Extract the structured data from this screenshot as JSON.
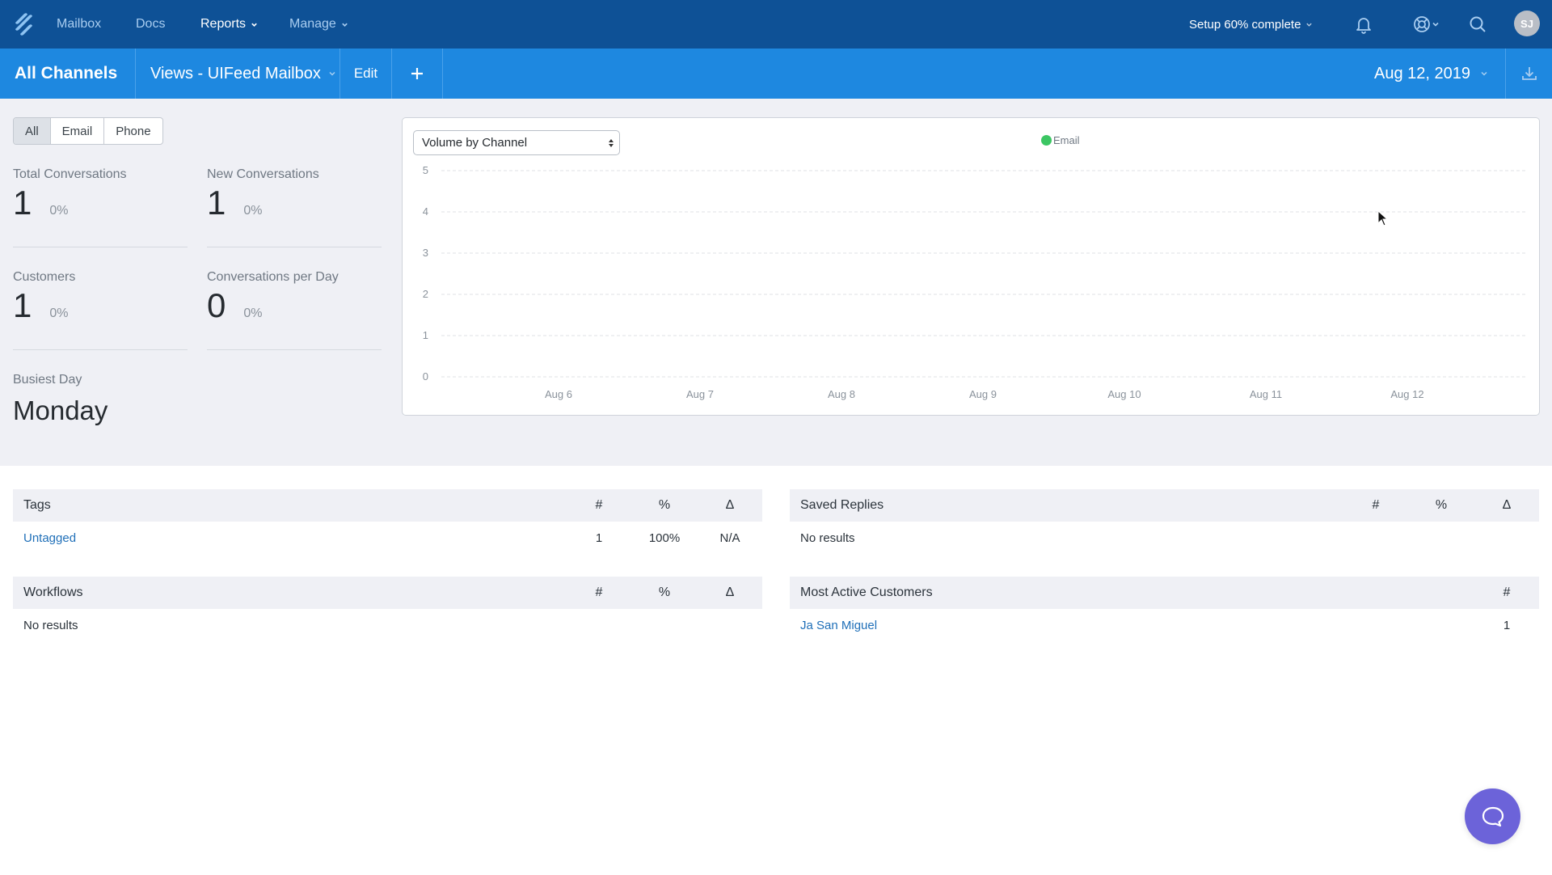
{
  "nav": {
    "items": [
      {
        "label": "Mailbox",
        "dropdown": false,
        "active": false
      },
      {
        "label": "Docs",
        "dropdown": false,
        "active": false
      },
      {
        "label": "Reports",
        "dropdown": true,
        "active": true
      },
      {
        "label": "Manage",
        "dropdown": true,
        "active": false
      }
    ],
    "setup_label": "Setup 60% complete",
    "setup_progress_pct": 60,
    "icons": [
      "bell-icon",
      "help-lifebuoy-icon",
      "search-icon"
    ],
    "avatar_initials": "SJ"
  },
  "subnav": {
    "title": "All Channels",
    "view_label": "Views - UIFeed Mailbox",
    "edit_label": "Edit",
    "add_icon": "plus-icon",
    "date_label": "Aug 12, 2019",
    "download_icon": "download-icon"
  },
  "filters": {
    "options": [
      "All",
      "Email",
      "Phone"
    ],
    "selected": "All"
  },
  "stats": [
    {
      "label": "Total Conversations",
      "value": "1",
      "change": "0%"
    },
    {
      "label": "New Conversations",
      "value": "1",
      "change": "0%"
    },
    {
      "label": "Customers",
      "value": "1",
      "change": "0%"
    },
    {
      "label": "Conversations per Day",
      "value": "0",
      "change": "0%"
    }
  ],
  "busiest_day": {
    "label": "Busiest Day",
    "value": "Monday"
  },
  "chart_select": {
    "value": "Volume by Channel"
  },
  "chart_data": {
    "type": "line",
    "title": "Volume by Channel",
    "xlabel": "",
    "ylabel": "",
    "x": [
      "Aug 6",
      "Aug 7",
      "Aug 8",
      "Aug 9",
      "Aug 10",
      "Aug 11",
      "Aug 12"
    ],
    "yticks": [
      0,
      1,
      2,
      3,
      4,
      5
    ],
    "ylim": [
      0,
      5
    ],
    "grid": true,
    "legend": "top-center",
    "series": [
      {
        "name": "Email",
        "color": "#3cc663",
        "values": []
      }
    ]
  },
  "tables": {
    "tags": {
      "title": "Tags",
      "columns": [
        "#",
        "%",
        "Δ"
      ],
      "rows": [
        {
          "name": "Untagged",
          "count": "1",
          "pct": "100%",
          "delta": "N/A"
        }
      ]
    },
    "saved_replies": {
      "title": "Saved Replies",
      "columns": [
        "#",
        "%",
        "Δ"
      ],
      "empty": "No results"
    },
    "workflows": {
      "title": "Workflows",
      "columns": [
        "#",
        "%",
        "Δ"
      ],
      "empty": "No results"
    },
    "most_active_customers": {
      "title": "Most Active Customers",
      "columns": [
        "#"
      ],
      "rows": [
        {
          "name": "Ja San Miguel",
          "count": "1"
        }
      ]
    }
  },
  "chat_button_icon": "chat-bubble-icon"
}
